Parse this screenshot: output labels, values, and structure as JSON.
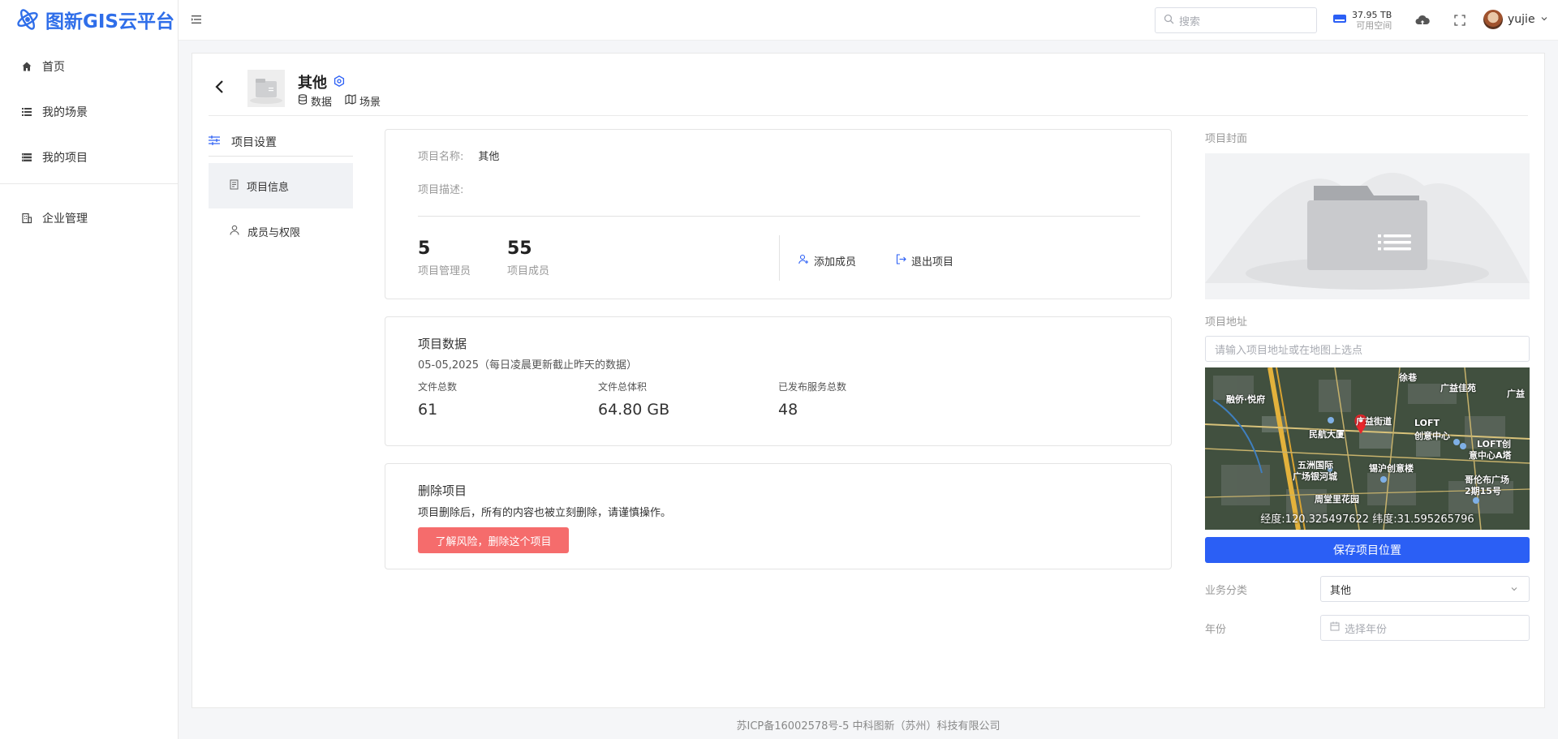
{
  "brand": {
    "name": "图新GIS云平台",
    "color": "#2f6ee9"
  },
  "sidebar": {
    "items": [
      {
        "label": "首页",
        "icon": "home-icon"
      },
      {
        "label": "我的场景",
        "icon": "list-icon"
      },
      {
        "label": "我的项目",
        "icon": "stack-icon"
      }
    ],
    "items2": [
      {
        "label": "企业管理",
        "icon": "building-icon"
      }
    ]
  },
  "header": {
    "search_placeholder": "搜索",
    "disk_total": "37.95 TB",
    "disk_label": "可用空间",
    "username": "yujie"
  },
  "project": {
    "title": "其他",
    "link_data": "数据",
    "link_scene": "场景"
  },
  "settings_menu": {
    "title": "项目设置",
    "items": [
      {
        "label": "项目信息",
        "active": true
      },
      {
        "label": "成员与权限",
        "active": false
      }
    ]
  },
  "info": {
    "name_label": "项目名称:",
    "name_value": "其他",
    "desc_label": "项目描述:",
    "desc_value": "",
    "admins_count": "5",
    "admins_label": "项目管理员",
    "members_count": "55",
    "members_label": "项目成员",
    "add_member": "添加成员",
    "exit_project": "退出项目"
  },
  "stats": {
    "title": "项目数据",
    "subtitle": "05-05,2025（每日凌晨更新截止昨天的数据）",
    "files_label": "文件总数",
    "files_value": "61",
    "size_label": "文件总体积",
    "size_value": "64.80 GB",
    "services_label": "已发布服务总数",
    "services_value": "48"
  },
  "delete": {
    "title": "删除项目",
    "warning": "项目删除后，所有的内容也被立刻删除，请谨慎操作。",
    "button": "了解风险，删除这个项目",
    "color": "#f56c6c"
  },
  "right": {
    "cover_label": "项目封面",
    "address_label": "项目地址",
    "address_placeholder": "请输入项目地址或在地图上选点",
    "coords": "经度:120.325497622  纬度:31.595265796",
    "map_labels": [
      "融侨·悦府",
      "徐巷",
      "广益佳苑",
      "广益街道",
      "LOFT",
      "创意中心",
      "民航大厦",
      "LOFT创",
      "意中心A塔",
      "五洲国际",
      "广场银河城",
      "锡沪创意楼",
      "哥伦布广场",
      "2期15号",
      "周堂里花园",
      "广益"
    ],
    "save_button": "保存项目位置",
    "save_color": "#2b5ff5",
    "category_label": "业务分类",
    "category_value": "其他",
    "year_label": "年份",
    "year_placeholder": "选择年份"
  },
  "footer": "苏ICP备16002578号-5 中科图新（苏州）科技有限公司"
}
